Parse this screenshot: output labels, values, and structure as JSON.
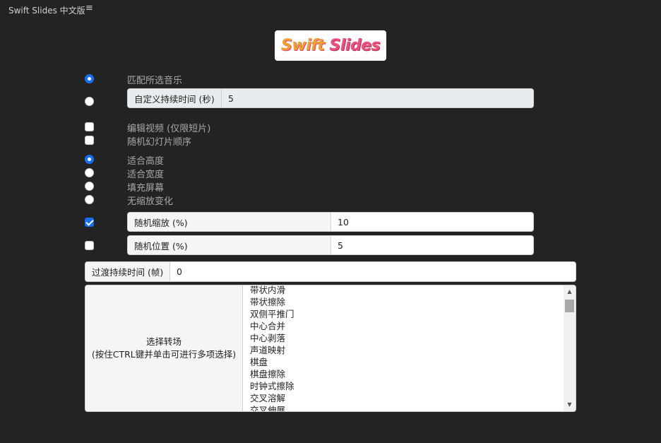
{
  "app": {
    "title": "Swift Slides 中文版",
    "menu_icon": "≡"
  },
  "logo": {
    "part1": "Swift",
    "part2": "Slides"
  },
  "duration": {
    "match_music": "匹配所选音乐",
    "custom_label": "自定义持续时间 (秒)",
    "custom_value": "5"
  },
  "options": {
    "edit_video": "编辑视频 (仅限短片)",
    "random_order": "随机幻灯片顺序"
  },
  "scaling": {
    "fit_height": "适合高度",
    "fit_width": "适合宽度",
    "fill_screen": "填充屏幕",
    "no_scale": "无缩放变化"
  },
  "random_zoom": {
    "label": "随机缩放 (%)",
    "value": "10"
  },
  "random_position": {
    "label": "随机位置 (%)",
    "value": "5"
  },
  "transition_duration": {
    "label": "过渡持续时间 (帧)",
    "value": "0"
  },
  "transition_select": {
    "label_line1": "选择转场",
    "label_line2": "(按住CTRL键并单击可进行多项选择)",
    "options": [
      "带状内滑",
      "带状擦除",
      "双侧平推门",
      "中心合并",
      "中心剥落",
      "声道映射",
      "棋盘",
      "棋盘擦除",
      "时钟式擦除",
      "交叉溶解",
      "交叉伸展"
    ]
  },
  "colors": {
    "accent": "#1a6ff0",
    "background": "#232323"
  }
}
